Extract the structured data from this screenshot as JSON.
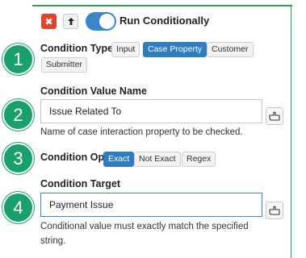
{
  "toolbar": {
    "delete_icon": "x-icon",
    "move_up_icon": "arrow-up-icon",
    "toggle_label": "Run Conditionally",
    "toggle_on": true
  },
  "steps": [
    "1",
    "2",
    "3",
    "4"
  ],
  "condition_type": {
    "label": "Condition Type",
    "options": [
      "Input",
      "Case Property",
      "Customer",
      "Submitter"
    ],
    "selected": "Case Property"
  },
  "condition_value_name": {
    "label": "Condition Value Name",
    "value": "Issue Related To",
    "help": "Name of case interaction property to be checked."
  },
  "condition_op": {
    "label": "Condition Op",
    "options": [
      "Exact",
      "Not Exact",
      "Regex"
    ],
    "selected": "Exact"
  },
  "condition_target": {
    "label": "Condition Target",
    "value": "Payment Issue",
    "help_line1": "Conditional value must exactly match the specified",
    "help_line2": "string."
  },
  "colors": {
    "accent_green": "#1aa06a",
    "active_blue": "#2f7dbf",
    "delete_red": "#e0432e"
  }
}
